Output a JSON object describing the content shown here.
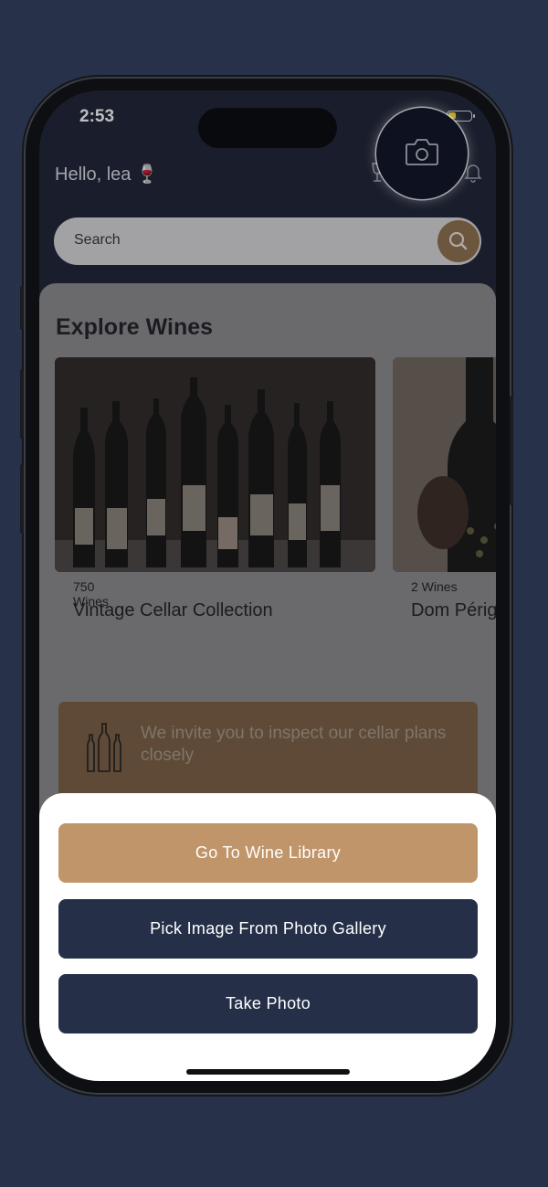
{
  "status_bar": {
    "time": "2:53"
  },
  "header": {
    "greeting": "Hello, lea 🍷",
    "search_placeholder": "Search"
  },
  "explore": {
    "title": "Explore Wines",
    "cards": [
      {
        "count": "750 Wines",
        "title": "Vintage Cellar Collection"
      },
      {
        "count": "2  Wines",
        "title": "Dom Pérignon"
      }
    ]
  },
  "banner": {
    "text": "We invite you to inspect our cellar plans closely"
  },
  "sheet": {
    "buttons": [
      {
        "label": "Go To Wine Library",
        "color": "#c0956a"
      },
      {
        "label": "Pick Image From Photo Gallery",
        "color": "#253048"
      },
      {
        "label": "Take Photo",
        "color": "#253048"
      }
    ]
  },
  "colors": {
    "background": "#27324a",
    "accent": "#c0956a",
    "navy": "#253048"
  },
  "icons": [
    "camera-icon",
    "wine-glass-icon",
    "bell-icon",
    "search-icon",
    "wine-bottles-icon",
    "battery-icon"
  ]
}
